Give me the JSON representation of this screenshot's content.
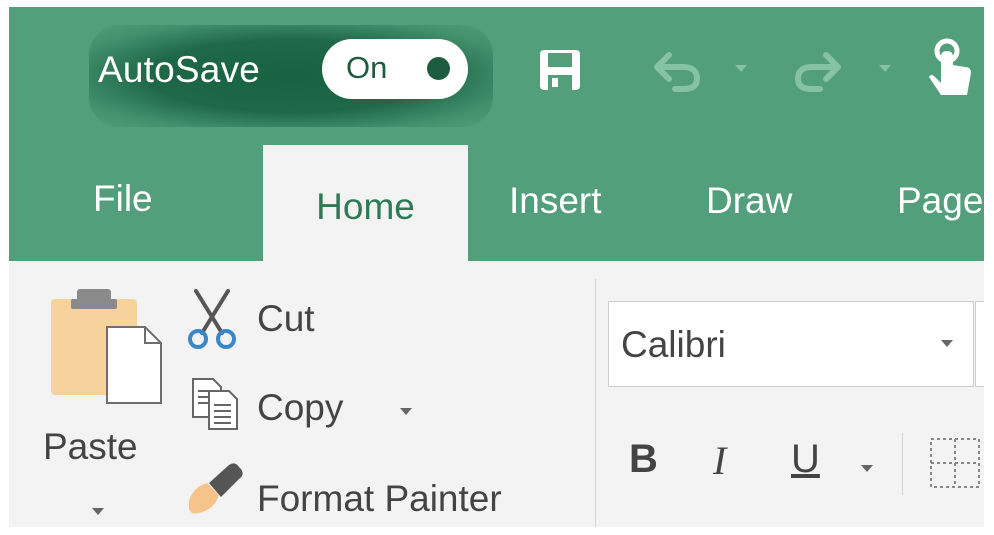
{
  "titlebar": {
    "autosave_label": "AutoSave",
    "autosave_state": "On",
    "icons": [
      "save-icon",
      "undo-icon",
      "redo-icon",
      "touch-mode-icon"
    ],
    "accent_color": "#539e7b"
  },
  "tabs": [
    {
      "label": "File",
      "active": false
    },
    {
      "label": "Home",
      "active": true
    },
    {
      "label": "Insert",
      "active": false
    },
    {
      "label": "Draw",
      "active": false
    },
    {
      "label": "Page",
      "active": false
    }
  ],
  "clipboard": {
    "paste_label": "Paste",
    "cut_label": "Cut",
    "copy_label": "Copy",
    "format_painter_label": "Format Painter"
  },
  "font": {
    "name": "Calibri",
    "bold_label": "B",
    "italic_label": "I",
    "underline_label": "U"
  }
}
